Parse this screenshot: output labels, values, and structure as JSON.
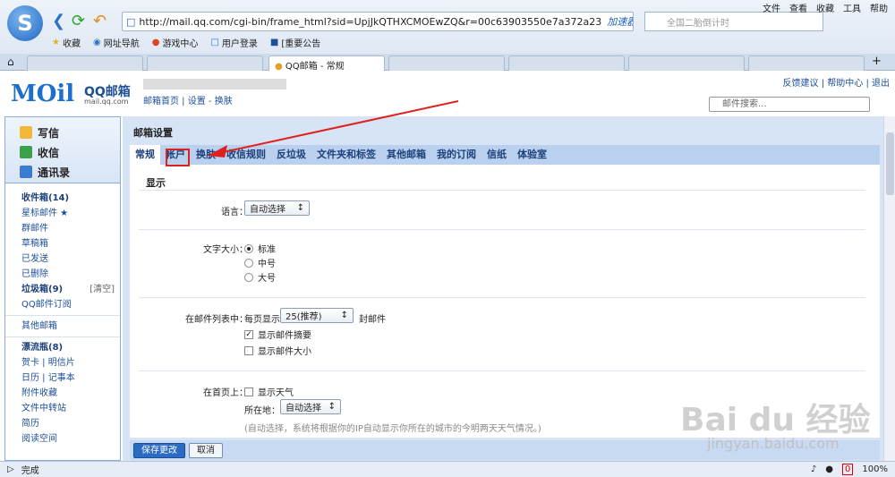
{
  "browser": {
    "url": "http://mail.qq.com/cgi-bin/frame_html?sid=UpjJkQTHXCMOEwZQ&r=00c63903550e7a372a23",
    "accelerator": "加速器",
    "search_placeholder": "全国二胎倒计时",
    "menus": [
      "文件",
      "查看",
      "收藏",
      "工具",
      "帮助"
    ],
    "bookmarks": [
      "收藏",
      "网址导航",
      "游戏中心",
      "用户登录",
      "[重要公告"
    ],
    "active_tab": "QQ邮箱 - 常规",
    "status": "完成",
    "zoom": "100%",
    "badge": "0"
  },
  "mail": {
    "logo_main": "MOil",
    "logo_cn": "QQ邮箱",
    "logo_sub": "mail.qq.com",
    "links": "邮箱首页 | 设置 - 换肤",
    "top_links": "反馈建议 | 帮助中心 | 退出",
    "search_placeholder": "邮件搜索..."
  },
  "sidebar": {
    "compose": "写信",
    "inbox_btn": "收信",
    "contacts": "通讯录",
    "items": [
      {
        "label": "收件箱(14)",
        "bold": true
      },
      {
        "label": "星标邮件 ★",
        "bold": false
      },
      {
        "label": "群邮件",
        "bold": false
      },
      {
        "label": "草稿箱",
        "bold": false
      },
      {
        "label": "已发送",
        "bold": false
      },
      {
        "label": "已删除",
        "bold": false
      },
      {
        "label": "垃圾箱(9)",
        "bold": true,
        "extra": "[清空]"
      },
      {
        "label": "QQ邮件订阅",
        "bold": false
      }
    ],
    "items2": [
      {
        "label": "其他邮箱",
        "bold": false
      }
    ],
    "items3": [
      {
        "label": "漂流瓶(8)",
        "bold": true
      },
      {
        "label": "贺卡 | 明信片",
        "bold": false
      },
      {
        "label": "日历 | 记事本",
        "bold": false
      },
      {
        "label": "附件收藏",
        "bold": false
      },
      {
        "label": "文件中转站",
        "bold": false
      },
      {
        "label": "简历",
        "bold": false
      },
      {
        "label": "阅读空间",
        "bold": false
      }
    ]
  },
  "settings": {
    "title": "邮箱设置",
    "tabs": [
      "常规",
      "帐户",
      "换肤",
      "收信规则",
      "反垃圾",
      "文件夹和标签",
      "其他邮箱",
      "我的订阅",
      "信纸",
      "体验室"
    ],
    "section": "显示",
    "language_label": "语言：",
    "language_value": "自动选择",
    "fontsize_label": "文字大小：",
    "fontsize_options": [
      "标准",
      "中号",
      "大号"
    ],
    "list_label": "在邮件列表中：",
    "per_page_label": "每页显示",
    "per_page_value": "25(推荐)",
    "per_page_unit": "封邮件",
    "show_summary": "显示邮件摘要",
    "show_size": "显示邮件大小",
    "home_label": "在首页上：",
    "show_weather": "显示天气",
    "location_label": "所在地：",
    "location_value": "自动选择",
    "location_hint": "(自动选择，系统将根据你的IP自动显示你所在的城市的今明两天天气情况。)",
    "save": "保存更改",
    "cancel": "取消"
  },
  "watermark": {
    "main": "Bai du 经验",
    "sub": "jingyan.baidu.com"
  }
}
